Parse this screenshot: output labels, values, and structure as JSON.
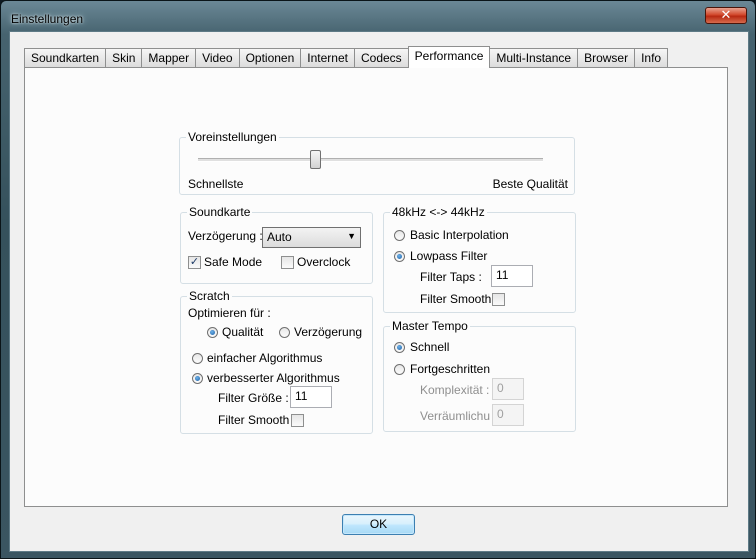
{
  "window": {
    "title": "Einstellungen",
    "close_symbol": "✕"
  },
  "tabs": [
    {
      "label": "Soundkarten"
    },
    {
      "label": "Skin"
    },
    {
      "label": "Mapper"
    },
    {
      "label": "Video"
    },
    {
      "label": "Optionen"
    },
    {
      "label": "Internet"
    },
    {
      "label": "Codecs"
    },
    {
      "label": "Performance",
      "active": true
    },
    {
      "label": "Multi-Instance"
    },
    {
      "label": "Browser"
    },
    {
      "label": "Info"
    }
  ],
  "voreinstellungen": {
    "label": "Voreinstellungen",
    "slider_position": 0.34,
    "left_label": "Schnellste",
    "right_label": "Beste Qualität"
  },
  "soundkarte": {
    "label": "Soundkarte",
    "latency_label": "Verzögerung :",
    "latency_value": "Auto",
    "safe_mode": {
      "label": "Safe Mode",
      "checked": true
    },
    "overclock": {
      "label": "Overclock",
      "checked": false
    }
  },
  "scratch": {
    "label": "Scratch",
    "optimize_label": "Optimieren für :",
    "opt_quality": {
      "label": "Qualität",
      "checked": true
    },
    "opt_latency": {
      "label": "Verzögerung",
      "checked": false
    },
    "alg_simple": {
      "label": "einfacher Algorithmus",
      "checked": false
    },
    "alg_improved": {
      "label": "verbesserter Algorithmus",
      "checked": true
    },
    "filter_size_label": "Filter Größe :",
    "filter_size_value": "11",
    "filter_smooth_label": "Filter Smooth",
    "filter_smooth_checked": false
  },
  "resample": {
    "label": "48kHz <-> 44kHz",
    "basic": {
      "label": "Basic Interpolation",
      "checked": false
    },
    "lowpass": {
      "label": "Lowpass Filter",
      "checked": true
    },
    "filter_taps_label": "Filter Taps :",
    "filter_taps_value": "11",
    "filter_smooth_label": "Filter Smooth",
    "filter_smooth_checked": false
  },
  "master_tempo": {
    "label": "Master Tempo",
    "fast": {
      "label": "Schnell",
      "checked": true
    },
    "advanced": {
      "label": "Fortgeschritten",
      "checked": false
    },
    "complexity_label": "Komplexität :",
    "complexity_value": "0",
    "smearing_label": "Verräumlichung",
    "smearing_value": "0"
  },
  "ok_label": "OK",
  "colors": {
    "accent": "#3c7fb1",
    "radio_dot": "#1b5fa6"
  }
}
